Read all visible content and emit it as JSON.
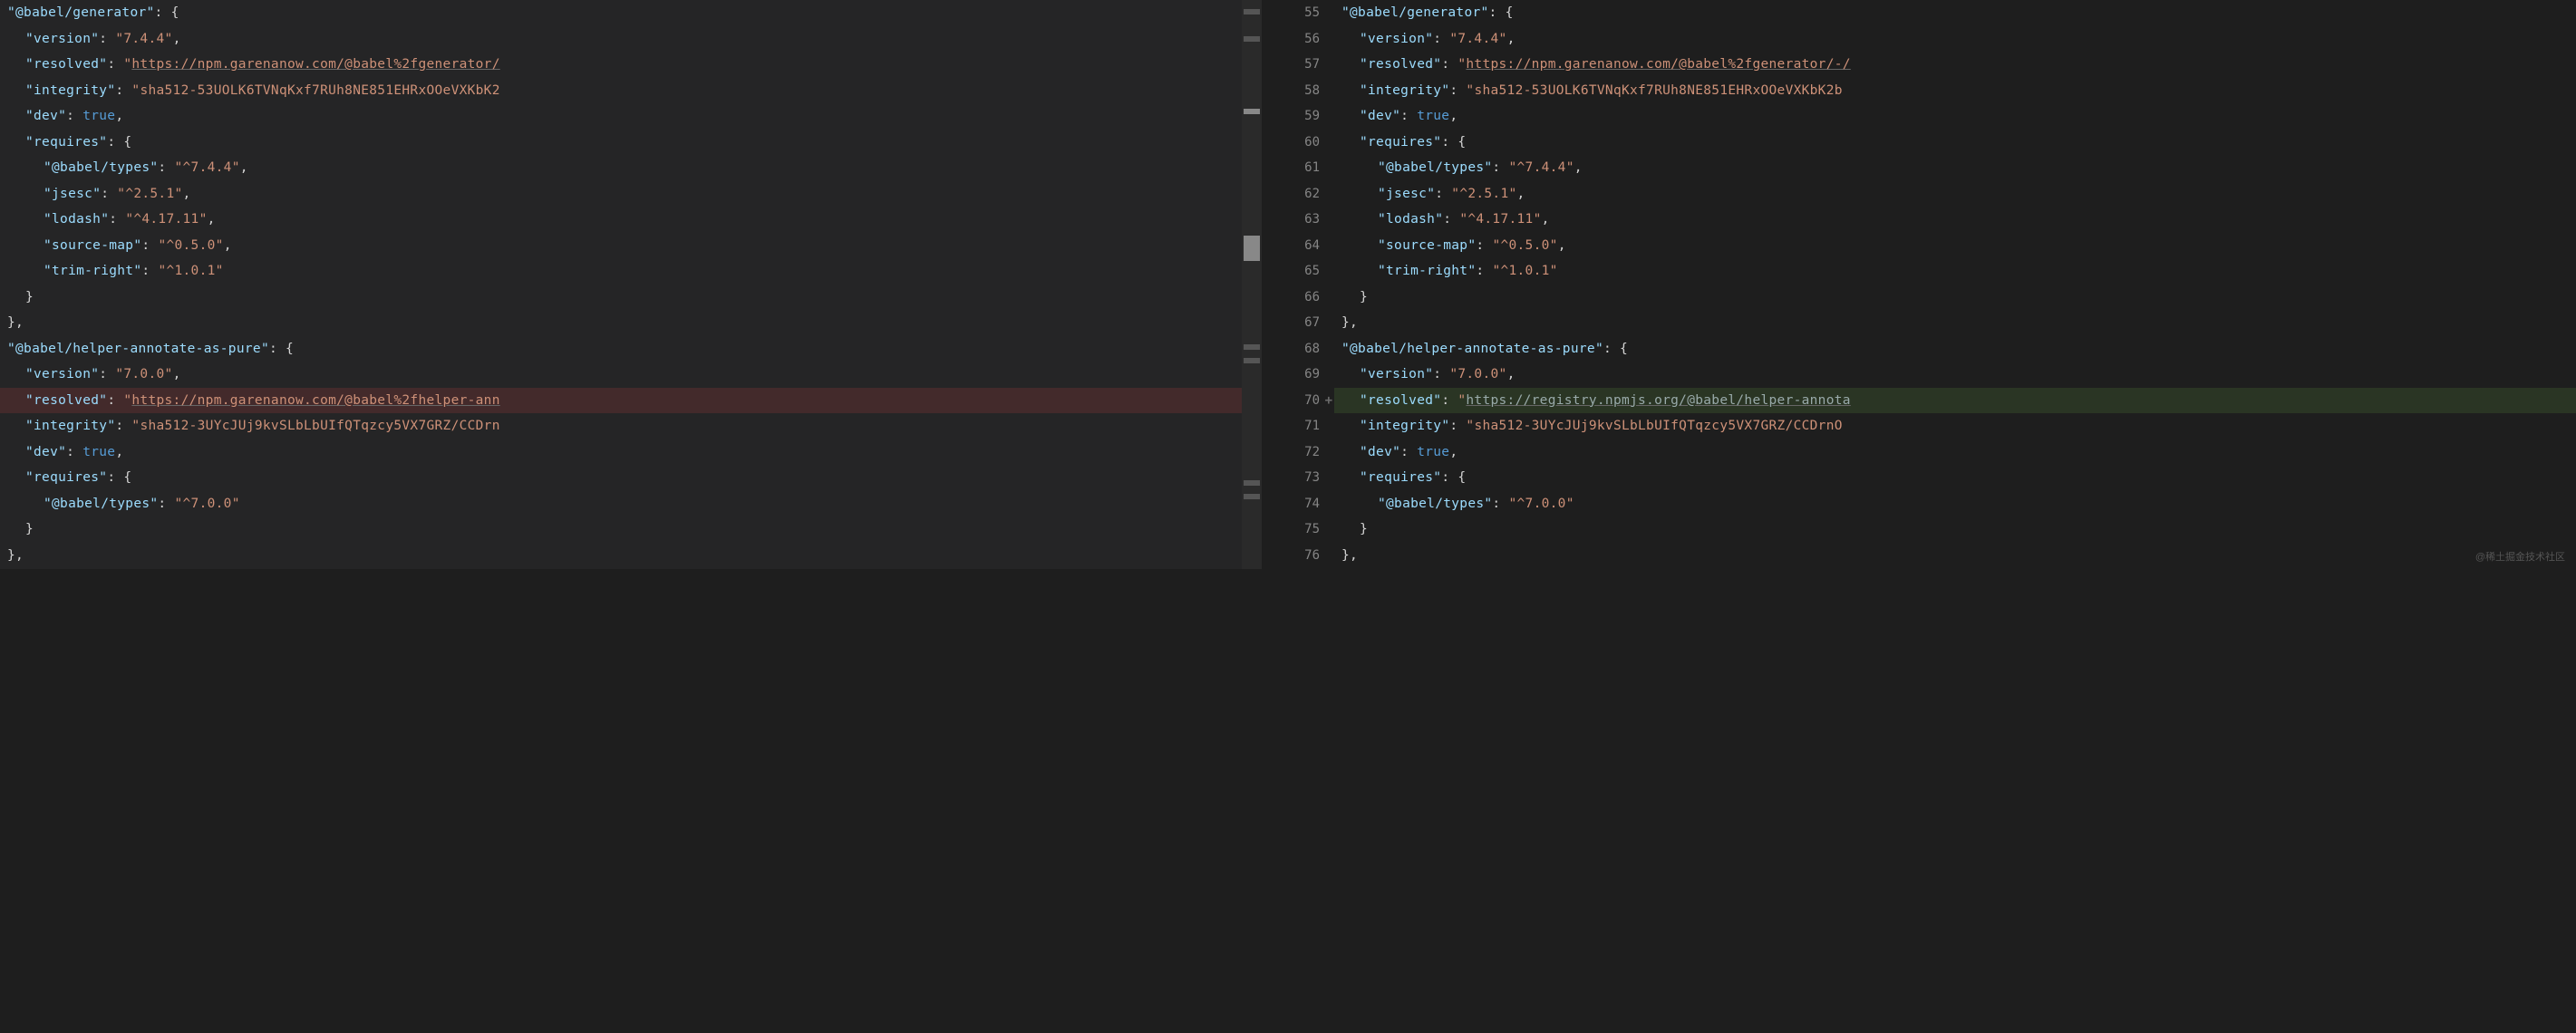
{
  "line_numbers": [
    "55",
    "56",
    "57",
    "58",
    "59",
    "60",
    "61",
    "62",
    "63",
    "64",
    "65",
    "66",
    "67",
    "68",
    "69",
    "70",
    "71",
    "72",
    "73",
    "74",
    "75",
    "76"
  ],
  "diff_line_index": 15,
  "diff_marker": "+",
  "watermark": "@稀土掘金技术社区",
  "left": {
    "pkg1_name": "@babel/generator",
    "version_key": "version",
    "version_val": "7.4.4",
    "resolved_key": "resolved",
    "resolved_val": "https://npm.garenanow.com/@babel%2fgenerator/",
    "integrity_key": "integrity",
    "integrity_val": "sha512-53UOLK6TVNqKxf7RUh8NE851EHRxOOeVXKbK2",
    "dev_key": "dev",
    "dev_val": "true",
    "requires_key": "requires",
    "req_types_key": "@babel/types",
    "req_types_val": "^7.4.4",
    "req_jsesc_key": "jsesc",
    "req_jsesc_val": "^2.5.1",
    "req_lodash_key": "lodash",
    "req_lodash_val": "^4.17.11",
    "req_sourcemap_key": "source-map",
    "req_sourcemap_val": "^0.5.0",
    "req_trimright_key": "trim-right",
    "req_trimright_val": "^1.0.1",
    "pkg2_name": "@babel/helper-annotate-as-pure",
    "p2_version_val": "7.0.0",
    "p2_resolved_val": "https://npm.garenanow.com/@babel%2fhelper-ann",
    "p2_integrity_val": "sha512-3UYcJUj9kvSLbLbUIfQTqzcy5VX7GRZ/CCDrn",
    "p2_req_types_val": "^7.0.0"
  },
  "right": {
    "pkg1_name": "@babel/generator",
    "version_key": "version",
    "version_val": "7.4.4",
    "resolved_key": "resolved",
    "resolved_val": "https://npm.garenanow.com/@babel%2fgenerator/-/",
    "integrity_key": "integrity",
    "integrity_val": "sha512-53UOLK6TVNqKxf7RUh8NE851EHRxOOeVXKbK2b",
    "dev_key": "dev",
    "dev_val": "true",
    "requires_key": "requires",
    "req_types_key": "@babel/types",
    "req_types_val": "^7.4.4",
    "req_jsesc_key": "jsesc",
    "req_jsesc_val": "^2.5.1",
    "req_lodash_key": "lodash",
    "req_lodash_val": "^4.17.11",
    "req_sourcemap_key": "source-map",
    "req_sourcemap_val": "^0.5.0",
    "req_trimright_key": "trim-right",
    "req_trimright_val": "^1.0.1",
    "pkg2_name": "@babel/helper-annotate-as-pure",
    "p2_version_val": "7.0.0",
    "p2_resolved_val": "https://registry.npmjs.org/@babel/helper-annota",
    "p2_integrity_val": "sha512-3UYcJUj9kvSLbLbUIfQTqzcy5VX7GRZ/CCDrnO",
    "p2_req_types_val": "^7.0.0"
  }
}
